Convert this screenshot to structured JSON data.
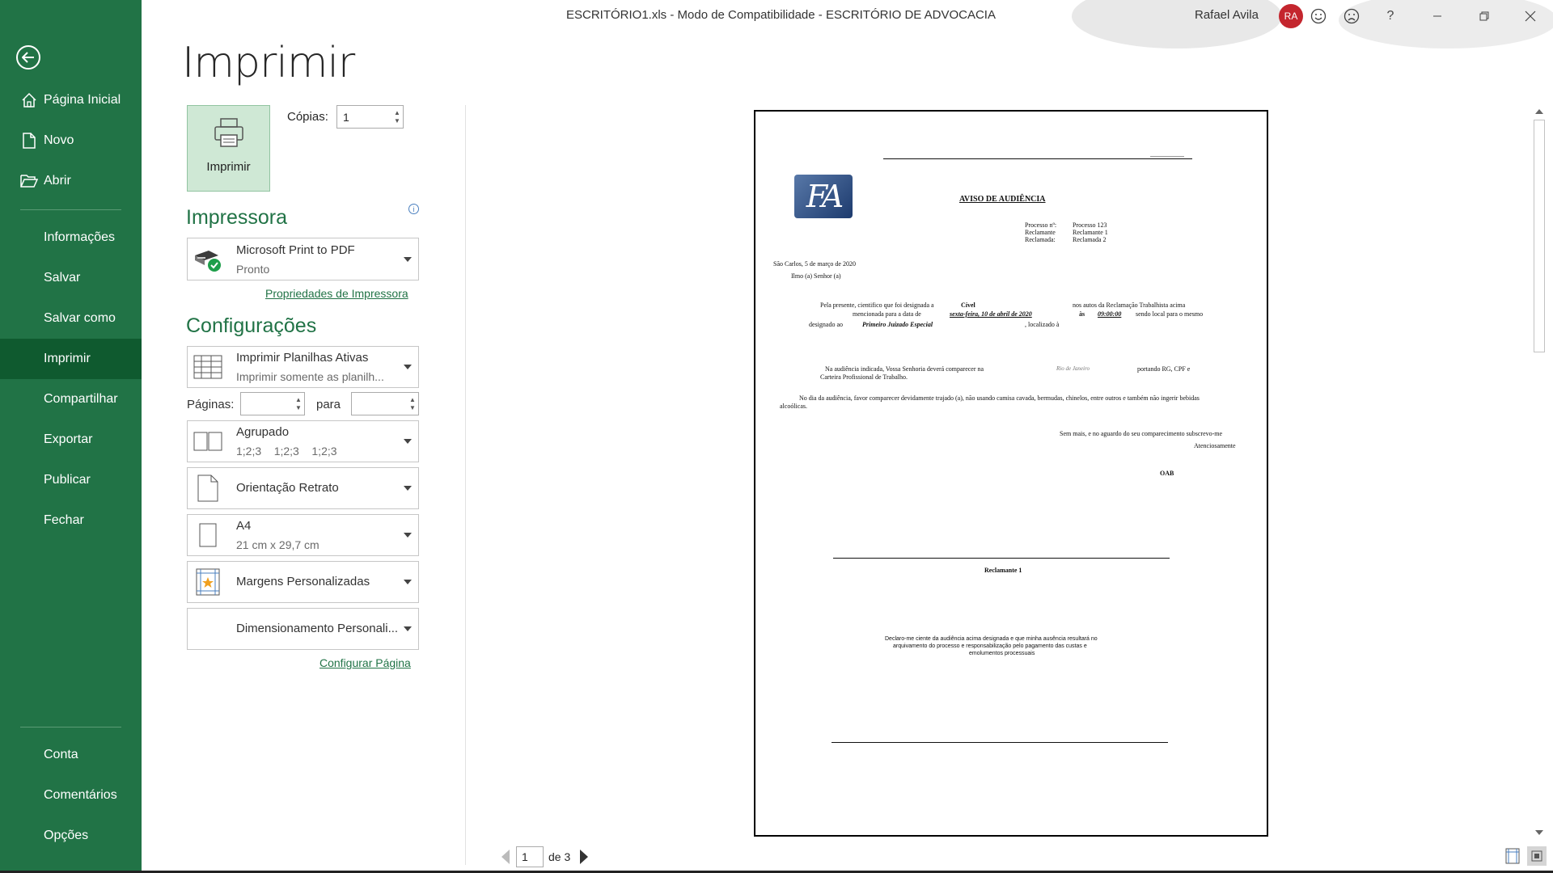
{
  "window": {
    "title": "ESCRITÓRIO1.xls  -  Modo de Compatibilidade  -  ESCRITÓRIO DE ADVOCACIA",
    "user_name": "Rafael Avila",
    "user_initials": "RA",
    "help": "?"
  },
  "sidebar": {
    "items": [
      {
        "label": "Página Inicial"
      },
      {
        "label": "Novo"
      },
      {
        "label": "Abrir"
      },
      {
        "label": "Informações"
      },
      {
        "label": "Salvar"
      },
      {
        "label": "Salvar como"
      },
      {
        "label": "Imprimir"
      },
      {
        "label": "Compartilhar"
      },
      {
        "label": "Exportar"
      },
      {
        "label": "Publicar"
      },
      {
        "label": "Fechar"
      },
      {
        "label": "Conta"
      },
      {
        "label": "Comentários"
      },
      {
        "label": "Opções"
      }
    ],
    "active": "Imprimir",
    "accent": "#217346"
  },
  "print": {
    "heading": "Imprimir",
    "print_button": "Imprimir",
    "copies_label": "Cópias:",
    "copies_value": "1",
    "printer_section": "Impressora",
    "printer_name": "Microsoft Print to PDF",
    "printer_status": "Pronto",
    "printer_properties_link": "Propriedades de Impressora",
    "settings_section": "Configurações",
    "sheets_main": "Imprimir Planilhas Ativas",
    "sheets_sub": "Imprimir somente as planilh...",
    "pages_label": "Páginas:",
    "pages_to_label": "para",
    "collate_main": "Agrupado",
    "collate_sub": "1;2;3    1;2;3    1;2;3",
    "orientation": "Orientação Retrato",
    "paper_main": "A4",
    "paper_sub": "21 cm x 29,7 cm",
    "margins": "Margens Personalizadas",
    "scaling": "Dimensionamento Personali...",
    "page_setup_link": "Configurar Página"
  },
  "preview": {
    "page_current": "1",
    "page_total_text": "de 3",
    "doc": {
      "logo_text": "FA",
      "title": "AVISO DE AUDIÊNCIA",
      "processo_label": "Processo nº:",
      "processo_value": "Processo 123",
      "reclamante_label": "Reclamante",
      "reclamante_value": "Reclamante 1",
      "reclamada_label": "Reclamada:",
      "reclamada_value": "Reclamada 2",
      "city_date": "São Carlos,  5 de março de 2020",
      "salutation": "Ilmo (a) Senhor (a)",
      "p1_a": "Pela presente, cientifico que foi designada a",
      "p1_b": "Cível",
      "p1_c": "nos autos da Reclamação Trabalhista acima",
      "p1_d": "mencionada para a data de",
      "p1_date": "sexta-feira, 10 de abril de 2020",
      "p1_as": "às",
      "p1_time": "09:00:00",
      "p1_e": "sendo local para o mesmo",
      "p1_f": "designado ao",
      "p1_place": "Primeiro Juizado Especial",
      "p1_g": ", localizado à",
      "p2_a": "Na audiência indicada, Vossa Senhoria deverá comparecer na",
      "p2_city": "Rio de Janeiro",
      "p2_b": "portando RG, CPF e",
      "p2_c": "Carteira Profissional de Trabalho.",
      "p3": "No dia da audiência, favor comparecer devidamente trajado (a), não usando camisa cavada, bermudas, chinelos, entre outros e também não ingerir bebidas",
      "p3b": "alcoólicas.",
      "closing1": "Sem mais, e no aguardo do seu comparecimento subscrevo-me",
      "closing2": "Atenciosamente",
      "oab": "OAB",
      "signer": "Reclamante 1",
      "decl1": "Declaro-me ciente da audiência acima designada e que minha ausência resultará no",
      "decl2": "arquivamento do processo e responsabilização pelo pagamento das custas e",
      "decl3": "emolumentos processuais"
    }
  }
}
